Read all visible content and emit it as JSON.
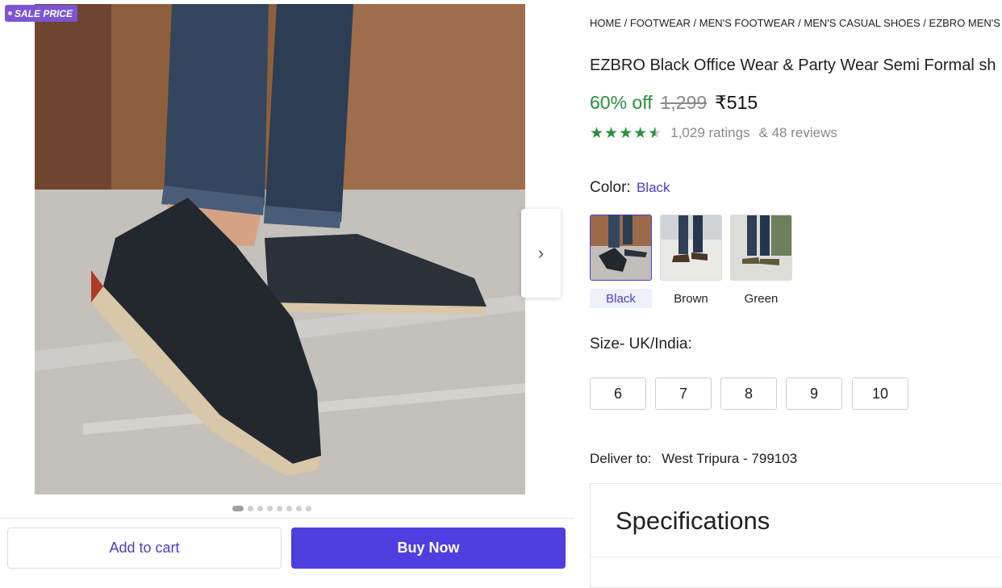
{
  "badge": {
    "label": "SALE PRICE"
  },
  "gallery": {
    "next_icon": "chevron-right-icon",
    "dot_count": 8,
    "active_dot": 0
  },
  "actions": {
    "add_to_cart": "Add to cart",
    "buy_now": "Buy Now"
  },
  "product": {
    "breadcrumb": "HOME / FOOTWEAR / MEN'S FOOTWEAR / MEN'S CASUAL SHOES / EZBRO MEN'S CAS",
    "title": "EZBRO Black Office Wear & Party Wear Semi Formal sh",
    "discount": "60% off",
    "mrp": "1,299",
    "price": "₹515",
    "rating_value": 4.5,
    "ratings_text": "1,029 ratings",
    "reviews_text": "& 48 reviews"
  },
  "color": {
    "label": "Color:",
    "selected": "Black",
    "options": [
      {
        "label": "Black"
      },
      {
        "label": "Brown"
      },
      {
        "label": "Green"
      }
    ]
  },
  "size": {
    "label": "Size- UK/India:",
    "options": [
      "6",
      "7",
      "8",
      "9",
      "10"
    ]
  },
  "delivery": {
    "label": "Deliver to:",
    "location": "West Tripura - 799103"
  },
  "specifications": {
    "title": "Specifications"
  },
  "colors": {
    "accent": "#4a3fc2",
    "buy_button": "#4f3ee0",
    "discount_green": "#2a8f3f",
    "badge": "#7b55d4"
  }
}
